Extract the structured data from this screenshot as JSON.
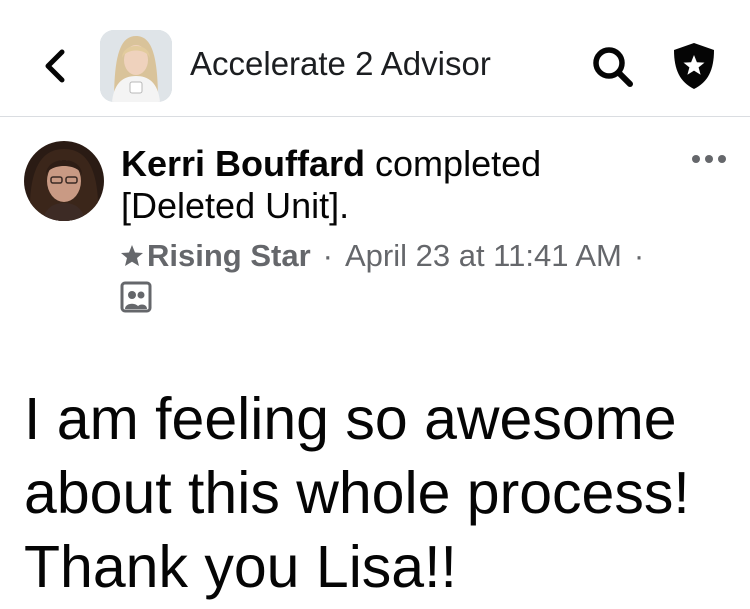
{
  "header": {
    "back_icon": "chevron-left-icon",
    "group_name": "Accelerate 2 Advisor",
    "search_icon": "search-icon",
    "admin_icon": "shield-star-icon"
  },
  "post": {
    "author": "Kerri Bouffard",
    "action": " completed",
    "unit": "[Deleted Unit].",
    "badge_icon": "star-badge-icon",
    "badge": "Rising Star",
    "separator": "·",
    "timestamp": "April 23 at 11:41 AM",
    "audience_icon": "group-members-icon",
    "more_icon": "more-horizontal-icon",
    "body_lines": [
      "I am feeling so awesome",
      "about this whole process!",
      "Thank you Lisa!!"
    ]
  },
  "colors": {
    "text_primary": "#050505",
    "text_secondary": "#65676b",
    "divider": "#dadde1"
  }
}
